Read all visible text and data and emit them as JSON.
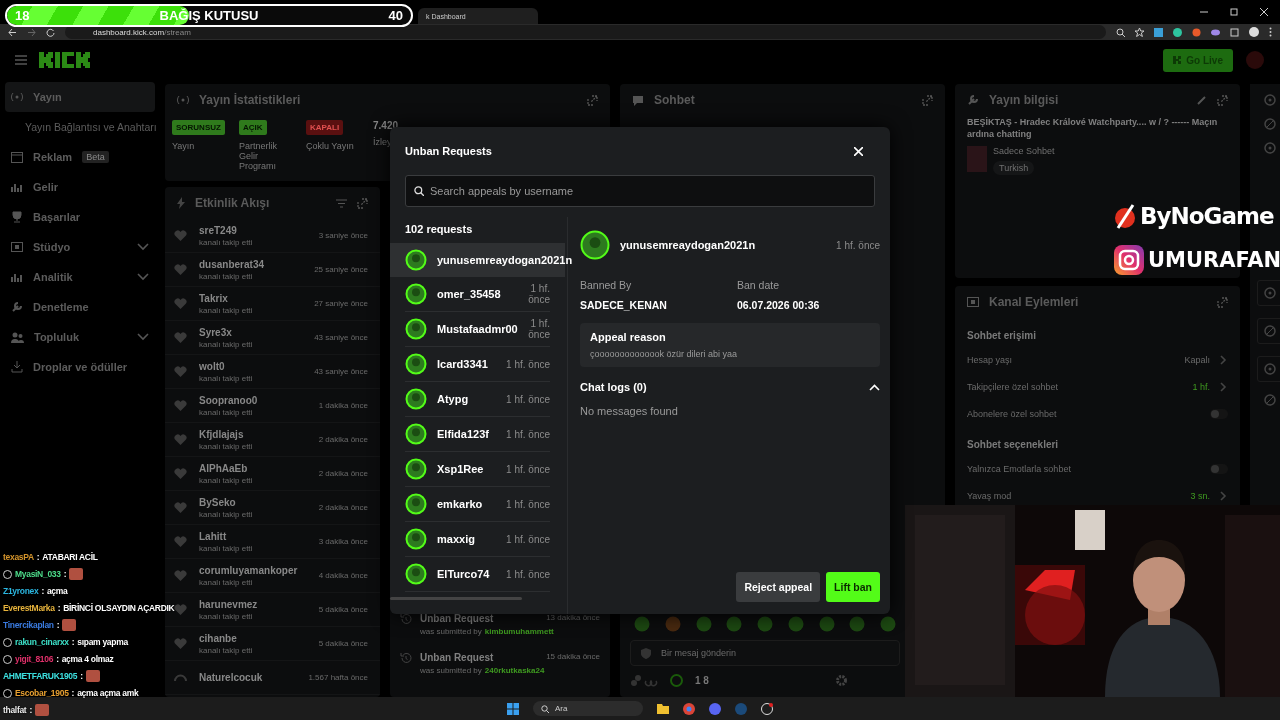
{
  "donation": {
    "current": "18",
    "title": "BAĞIŞ KUTUSU",
    "goal": "40",
    "level": 0.45
  },
  "browser": {
    "tab_title": "k Dashboard",
    "url_host": "dashboard.kick.com",
    "url_path": "/stream"
  },
  "header": {
    "go_live": "Go Live"
  },
  "nav": [
    {
      "label": "Yayın",
      "kind": "main",
      "selected": true
    },
    {
      "label": "Yayın Bağlantısı ve Anahtarı",
      "kind": "sub",
      "selected": false
    },
    {
      "label": "Reklam",
      "kind": "main",
      "badge": "Beta",
      "selected": false
    },
    {
      "label": "Gelir",
      "kind": "main",
      "selected": false
    },
    {
      "label": "Başarılar",
      "kind": "main",
      "selected": false
    },
    {
      "label": "Stüdyo",
      "kind": "main",
      "expandable": true,
      "selected": false
    },
    {
      "label": "Analitik",
      "kind": "main",
      "expandable": true,
      "selected": false
    },
    {
      "label": "Denetleme",
      "kind": "main",
      "selected": false
    },
    {
      "label": "Topluluk",
      "kind": "main",
      "expandable": true,
      "selected": false
    },
    {
      "label": "Droplar ve ödüller",
      "kind": "main",
      "selected": false
    }
  ],
  "stats": {
    "title": "Yayın İstatistikleri",
    "items": [
      {
        "kind": "positive",
        "badge": "SORUNSUZ",
        "label": "Yayın"
      },
      {
        "kind": "positive",
        "badge": "AÇIK",
        "label": "Partnerlik Gelir Programı"
      },
      {
        "kind": "negative",
        "badge": "KAPALI",
        "label": "Çoklu Yayın"
      },
      {
        "kind": "count",
        "badge": "7.420",
        "label": "İzley"
      }
    ]
  },
  "activity": {
    "title": "Etkinlik Akışı",
    "events": [
      {
        "name": "sreT249",
        "action": "kanalı takip etti",
        "time": "3 saniye önce"
      },
      {
        "name": "dusanberat34",
        "action": "kanalı takip etti",
        "time": "25 saniye önce"
      },
      {
        "name": "Takrix",
        "action": "kanalı takip etti",
        "time": "27 saniye önce"
      },
      {
        "name": "Syre3x",
        "action": "kanalı takip etti",
        "time": "43 saniye önce"
      },
      {
        "name": "wolt0",
        "action": "kanalı takip etti",
        "time": "43 saniye önce"
      },
      {
        "name": "Soopranoo0",
        "action": "kanalı takip etti",
        "time": "1 dakika önce"
      },
      {
        "name": "Kfjdlajajs",
        "action": "kanalı takip etti",
        "time": "2 dakika önce"
      },
      {
        "name": "AlPhAaEb",
        "action": "kanalı takip etti",
        "time": "2 dakika önce"
      },
      {
        "name": "BySeko",
        "action": "kanalı takip etti",
        "time": "2 dakika önce"
      },
      {
        "name": "Lahitt",
        "action": "kanalı takip etti",
        "time": "3 dakika önce"
      },
      {
        "name": "corumluyamankoper",
        "action": "kanalı takip etti",
        "time": "4 dakika önce"
      },
      {
        "name": "harunevmez",
        "action": "kanalı takip etti",
        "time": "5 dakika önce"
      },
      {
        "name": "cihanbe",
        "action": "kanalı takip etti",
        "time": "5 dakika önce"
      },
      {
        "name": "Naturelcocuk",
        "time": "1.567 hafta önce"
      }
    ]
  },
  "modlog": [
    {
      "title": "Unban Request",
      "time": "13 dakika önce",
      "prefix": "was submitted by",
      "user": "kimbumuhammett"
    },
    {
      "title": "Unban Request",
      "time": "15 dakika önce",
      "prefix": "was submitted by",
      "user": "240rkutkaska24"
    }
  ],
  "chat": {
    "title": "Sohbet",
    "placeholder": "Bir mesaj gönderin",
    "count": "1 8"
  },
  "info": {
    "title": "Yayın bilgisi",
    "stream_title": "BEŞİKTAŞ - Hradec Králové Watchparty.... w / ? ------ Maçın ardına chatting",
    "category": "Sadece Sohbet",
    "tag": "Turkish"
  },
  "actions": {
    "title": "Kanal Eylemleri",
    "sections": [
      {
        "title": "Sohbet erişimi",
        "rows": [
          {
            "label": "Hesap yaşı",
            "kind": "value",
            "value": "Kapalı",
            "active": false
          },
          {
            "label": "Takipçilere özel sohbet",
            "kind": "value",
            "value": "1 hf.",
            "active": true
          },
          {
            "label": "Abonelere özel sohbet",
            "kind": "toggle",
            "on": false
          }
        ]
      },
      {
        "title": "Sohbet seçenekleri",
        "rows": [
          {
            "label": "Yalnızca Emotlarla sohbet",
            "kind": "toggle",
            "on": false
          },
          {
            "label": "Yavaş mod",
            "kind": "value",
            "value": "3 sn.",
            "active": true
          }
        ]
      }
    ]
  },
  "modal": {
    "title": "Unban Requests",
    "search_placeholder": "Search appeals by username",
    "count": "102 requests",
    "requests": [
      {
        "name": "yunusemreaydogan2021n",
        "selected": true
      },
      {
        "name": "omer_35458",
        "time": "1 hf. önce",
        "selected": false
      },
      {
        "name": "Mustafaadmr00",
        "time": "1 hf. önce",
        "selected": false
      },
      {
        "name": "Icard3341",
        "time": "1 hf. önce",
        "selected": false
      },
      {
        "name": "Atypg",
        "time": "1 hf. önce",
        "selected": false
      },
      {
        "name": "Elfida123f",
        "time": "1 hf. önce",
        "selected": false
      },
      {
        "name": "Xsp1Ree",
        "time": "1 hf. önce",
        "selected": false
      },
      {
        "name": "emkarko",
        "time": "1 hf. önce",
        "selected": false
      },
      {
        "name": "maxxig",
        "time": "1 hf. önce",
        "selected": false
      },
      {
        "name": "ElTurco74",
        "time": "1 hf. önce",
        "selected": false
      }
    ],
    "detail": {
      "name": "yunusemreaydogan2021n",
      "time": "1 hf. önce",
      "banned_by_label": "Banned By",
      "banned_by": "SADECE_KENAN",
      "ban_date_label": "Ban date",
      "ban_date": "06.07.2026 00:36",
      "appeal_label": "Appeal reason",
      "appeal": "çoooooooooooook özür dileri abi yaa",
      "logs_title": "Chat logs (0)",
      "logs_expanded": true,
      "logs_empty": "No messages found"
    },
    "buttons": [
      {
        "label": "Reject appeal",
        "kind": "secondary"
      },
      {
        "label": "Lift ban",
        "kind": "primary"
      }
    ]
  },
  "stream_chat": [
    {
      "user": "texasPA",
      "sep": ":",
      "color": "#d4942b",
      "badge": false,
      "text": "ATABARI ACİL",
      "emote": false
    },
    {
      "user": "MyasiN_033",
      "sep": ":",
      "color": "#4ddc8a",
      "badge": true,
      "emote": true
    },
    {
      "user": "Z1yronex",
      "sep": ":",
      "color": "#2bb6e0",
      "badge": false,
      "text": "açma",
      "emote": false
    },
    {
      "user": "EverestMarka",
      "sep": ":",
      "color": "#e8b43c",
      "badge": false,
      "text": "BİRİNCİ OLSAYDIN AÇARDIK",
      "emote": false
    },
    {
      "user": "Tinercikaplan",
      "sep": ":",
      "color": "#3a7be0",
      "badge": false,
      "emote": true
    },
    {
      "user": "rakun_cinarxx",
      "sep": ":",
      "color": "#3ce0c8",
      "badge": true,
      "text": "sıpam yapma",
      "emote": false
    },
    {
      "user": "yigit_8106",
      "sep": ":",
      "color": "#e0306a",
      "badge": true,
      "text": "açma 4 olmaz",
      "emote": false
    },
    {
      "user": "AHMETFARUK1905",
      "sep": ":",
      "color": "#3ce0e0",
      "badge": false,
      "emote": true
    },
    {
      "user": "Escobar_1905",
      "sep": ":",
      "color": "#e8a030",
      "badge": true,
      "text": "açma açma amk",
      "emote": false
    },
    {
      "user": "thalfat",
      "sep": ":",
      "color": "#e8e8e8",
      "badge": false,
      "emote": true
    }
  ],
  "brand": {
    "sponsor": "ByNoGame",
    "instagram": "UMURAFAN"
  },
  "taskbar": {
    "search": "Ara"
  }
}
